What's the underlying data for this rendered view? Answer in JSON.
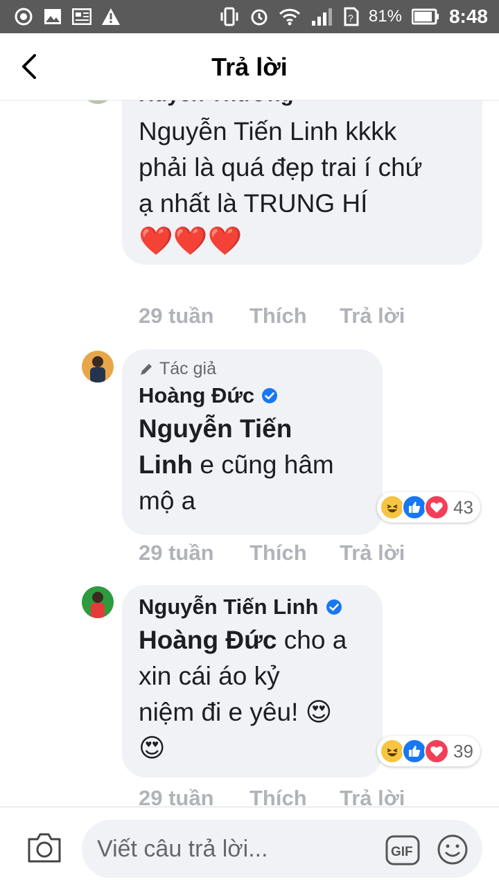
{
  "status_bar": {
    "battery_percent": "81%",
    "time": "8:48"
  },
  "header": {
    "title": "Trả lời"
  },
  "comments": [
    {
      "author": "Huyền Thương",
      "text": "Nguyễn Tiến Linh kkkk phải là quá đẹp trai í chứ ạ nhất là TRUNG HÍ",
      "line1": "Nguyễn Tiến Linh kkkk",
      "line2": "phải là quá đẹp trai í chứ",
      "line3": "ạ nhất là TRUNG HÍ",
      "emoji": "❤️❤️❤️",
      "time": "29 tuần",
      "like": "Thích",
      "reply": "Trả lời"
    },
    {
      "author_tag": "Tác giả",
      "author": "Hoàng Đức",
      "mention": "Nguyễn Tiến Linh",
      "mention_line1": "Nguyễn Tiến",
      "mention_line2": "Linh",
      "text_after": " e cũng hâm",
      "text_line3": "mộ a",
      "reaction_count": "43",
      "time": "29 tuần",
      "like": "Thích",
      "reply": "Trả lời"
    },
    {
      "author": "Nguyễn Tiến Linh",
      "mention": "Hoàng Đức",
      "text_after": " cho a",
      "text_line2": "xin cái áo kỷ",
      "text_line3": "niệm đi e yêu! ",
      "emoji": "😍",
      "reaction_count": "39",
      "time": "29 tuần",
      "like": "Thích",
      "reply": "Trả lời"
    }
  ],
  "composer": {
    "placeholder": "Viết câu trả lời..."
  },
  "colors": {
    "bubble": "#f0f2f5",
    "verified": "#1877f2",
    "like_blue": "#1877f2",
    "love_red": "#f33e58",
    "meta_grey": "#b0b3b8"
  }
}
